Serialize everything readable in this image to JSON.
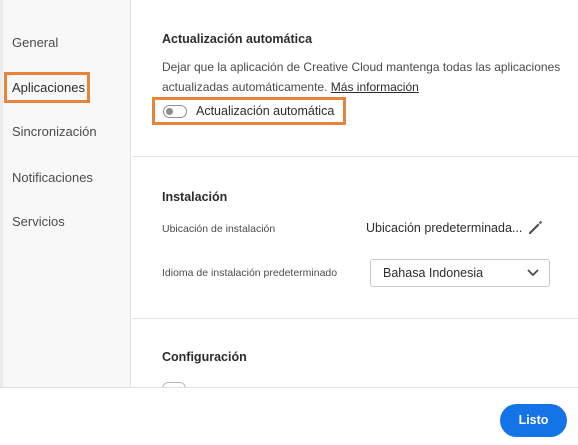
{
  "sidebar": {
    "items": [
      {
        "label": "General"
      },
      {
        "label": "Aplicaciones",
        "active": true
      },
      {
        "label": "Sincronización"
      },
      {
        "label": "Notificaciones"
      },
      {
        "label": "Servicios"
      }
    ]
  },
  "auto_update": {
    "title": "Actualización automática",
    "description": "Dejar que la aplicación de Creative Cloud mantenga todas las aplicaciones actualizadas automáticamente.",
    "more_info_link": "Más información",
    "toggle_label": "Actualización automática",
    "toggle_on": false
  },
  "installation": {
    "title": "Instalación",
    "location_label": "Ubicación de instalación",
    "location_value": "Ubicación predeterminada...",
    "language_label": "Idioma de instalación predeterminado",
    "language_value": "Bahasa Indonesia"
  },
  "configuration": {
    "title": "Configuración"
  },
  "footer": {
    "done_label": "Listo"
  },
  "colors": {
    "highlight": "#e8833a",
    "primary_button": "#1473e6"
  },
  "icons": {
    "edit": "pencil-icon",
    "dropdown": "chevron-down-icon"
  }
}
